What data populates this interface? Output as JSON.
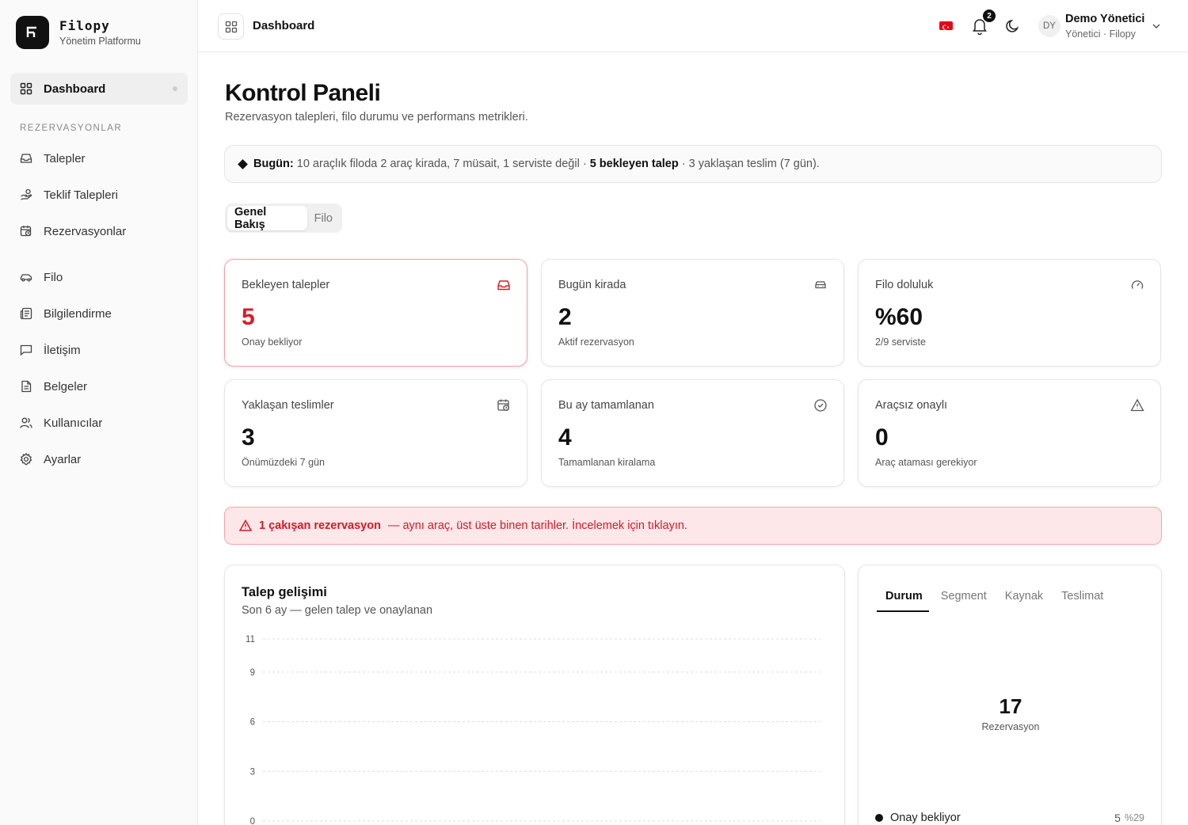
{
  "brand": {
    "name": "Filopy",
    "subtitle": "Yönetim Platformu",
    "logo_text": "FI"
  },
  "sidebar": {
    "dashboard": {
      "label": "Dashboard",
      "icon": "grid-icon"
    },
    "section_label": "REZERVASYONLAR",
    "items": [
      {
        "label": "Talepler",
        "icon": "inbox-icon"
      },
      {
        "label": "Teklif Talepleri",
        "icon": "hand-coins-icon"
      },
      {
        "label": "Rezervasyonlar",
        "icon": "calendar-clock-icon"
      },
      {
        "label": "Filo",
        "icon": "car-icon"
      },
      {
        "label": "Bilgilendirme",
        "icon": "newspaper-icon"
      },
      {
        "label": "İletişim",
        "icon": "message-square-icon"
      },
      {
        "label": "Belgeler",
        "icon": "file-text-icon"
      },
      {
        "label": "Kullanıcılar",
        "icon": "users-icon"
      },
      {
        "label": "Ayarlar",
        "icon": "settings-icon"
      }
    ]
  },
  "topbar": {
    "title": "Dashboard",
    "notification_count": "2",
    "user": {
      "initials": "DY",
      "name": "Demo Yönetici",
      "role": "Yönetici · Filopy"
    }
  },
  "page": {
    "title": "Kontrol Paneli",
    "subtitle": "Rezervasyon talepleri, filo durumu ve performans metrikleri."
  },
  "summary": {
    "prefix": "Bugün:",
    "text1": "10 araçlık filoda 2 araç kirada, 7 müsait, 1 serviste değil ·",
    "strong": "5 bekleyen talep",
    "text2": "· 3 yaklaşan teslim (7 gün)."
  },
  "tabs": [
    "Genel Bakış",
    "Filo"
  ],
  "cards": [
    {
      "title": "Bekleyen talepler",
      "value": "5",
      "sub": "Onay bekliyor",
      "icon": "inbox-icon"
    },
    {
      "title": "Bugün kirada",
      "value": "2",
      "sub": "Aktif rezervasyon",
      "icon": "car-icon"
    },
    {
      "title": "Filo doluluk",
      "value": "%60",
      "sub": "2/9 serviste",
      "icon": "gauge-icon"
    },
    {
      "title": "Yaklaşan teslimler",
      "value": "3",
      "sub": "Önümüzdeki 7 gün",
      "icon": "calendar-clock-icon"
    },
    {
      "title": "Bu ay tamamlanan",
      "value": "4",
      "sub": "Tamamlanan kiralama",
      "icon": "check-circle-icon"
    },
    {
      "title": "Araçsız onaylı",
      "value": "0",
      "sub": "Araç ataması gerekiyor",
      "icon": "alert-triangle-icon"
    }
  ],
  "alert": {
    "strong": "1 çakışan rezervasyon",
    "text": "— aynı araç, üst üste binen tarihler. İncelemek için tıklayın."
  },
  "chart_data": {
    "type": "line",
    "title": "Talep gelişimi",
    "subtitle": "Son 6 ay — gelen talep ve onaylanan",
    "yticks": [
      "11",
      "9",
      "6",
      "3",
      "0"
    ],
    "ylim": [
      0,
      11
    ],
    "grid": true
  },
  "donut": {
    "tabs": [
      "Durum",
      "Segment",
      "Kaynak",
      "Teslimat"
    ],
    "total": "17",
    "total_label": "Rezervasyon",
    "legend": [
      {
        "label": "Onay bekliyor",
        "value": "5",
        "pct": "%29"
      }
    ]
  }
}
